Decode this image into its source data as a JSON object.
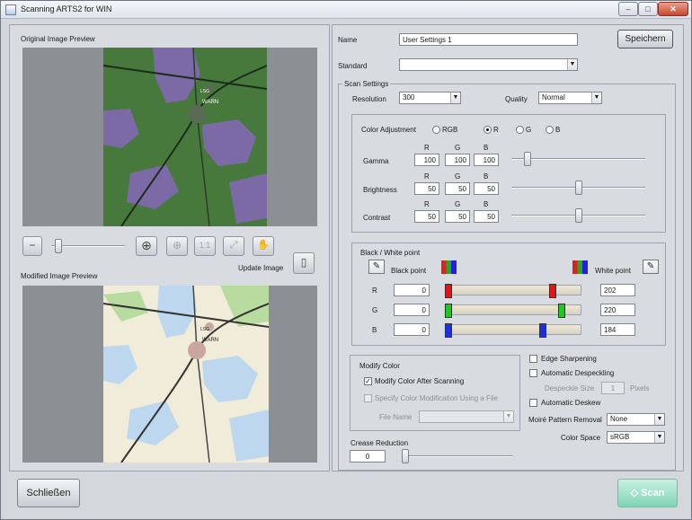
{
  "window": {
    "title": "Scanning ARTS2 for WIN",
    "controls": {
      "minimize": "–",
      "maximize": "□",
      "close": "✕"
    }
  },
  "left": {
    "original_label": "Original Image Preview",
    "modified_label": "Modified Image Preview",
    "update_image": "Update Image",
    "toolbar": {
      "zoom_out": "−",
      "zoom_fit": "1:1"
    },
    "map_labels": {
      "town": "WARN",
      "village": "LSG"
    }
  },
  "right": {
    "name_label": "Name",
    "name_value": "User Settings 1",
    "save_button": "Speichern",
    "standard_label": "Standard",
    "standard_value": "",
    "scan_settings": "Scan Settings",
    "resolution_label": "Resolution",
    "resolution_value": "300",
    "quality_label": "Quality",
    "quality_value": "Normal",
    "color_adjustment": {
      "label": "Color Adjustment",
      "options": [
        "RGB",
        "R",
        "G",
        "B"
      ],
      "selected": "R",
      "channel_headers": [
        "R",
        "G",
        "B"
      ],
      "gamma": {
        "label": "Gamma",
        "values": [
          "100",
          "100",
          "100"
        ],
        "slider": 0.12
      },
      "brightness": {
        "label": "Brightness",
        "values": [
          "50",
          "50",
          "50"
        ],
        "slider": 0.5
      },
      "contrast": {
        "label": "Contrast",
        "values": [
          "50",
          "50",
          "50"
        ],
        "slider": 0.5
      }
    },
    "bw": {
      "title": "Black / White point",
      "black_point": "Black point",
      "white_point": "White point",
      "rows": [
        {
          "channel": "R",
          "black": "0",
          "white": "202",
          "white_frac": 0.792,
          "color": "#e01616"
        },
        {
          "channel": "G",
          "black": "0",
          "white": "220",
          "white_frac": 0.863,
          "color": "#1ec81e"
        },
        {
          "channel": "B",
          "black": "0",
          "white": "184",
          "white_frac": 0.722,
          "color": "#1b2ee8"
        }
      ]
    },
    "modify_color": {
      "title": "Modify Color",
      "after_scanning": "Modify Color After Scanning",
      "using_file": "Specify Color Modification Using a File",
      "file_name": "File Name"
    },
    "edge_sharpening": "Edge Sharpening",
    "auto_despeckling": "Automatic Despeckling",
    "despeckle_size_label": "Despeckle Size",
    "despeckle_size_value": "1",
    "pixels": "Pixels",
    "auto_deskew": "Automatic Deskew",
    "moire_label": "Moiré Pattern Removal",
    "moire_value": "None",
    "color_space_label": "Color Space",
    "color_space_value": "sRGB",
    "crease_label": "Crease Reduction",
    "crease_value": "0"
  },
  "footer": {
    "close_button": "Schließen",
    "scan_button": "Scan"
  },
  "colors": {
    "scan_button": "#8fdcc2",
    "accent_black_point": "#e01616"
  }
}
